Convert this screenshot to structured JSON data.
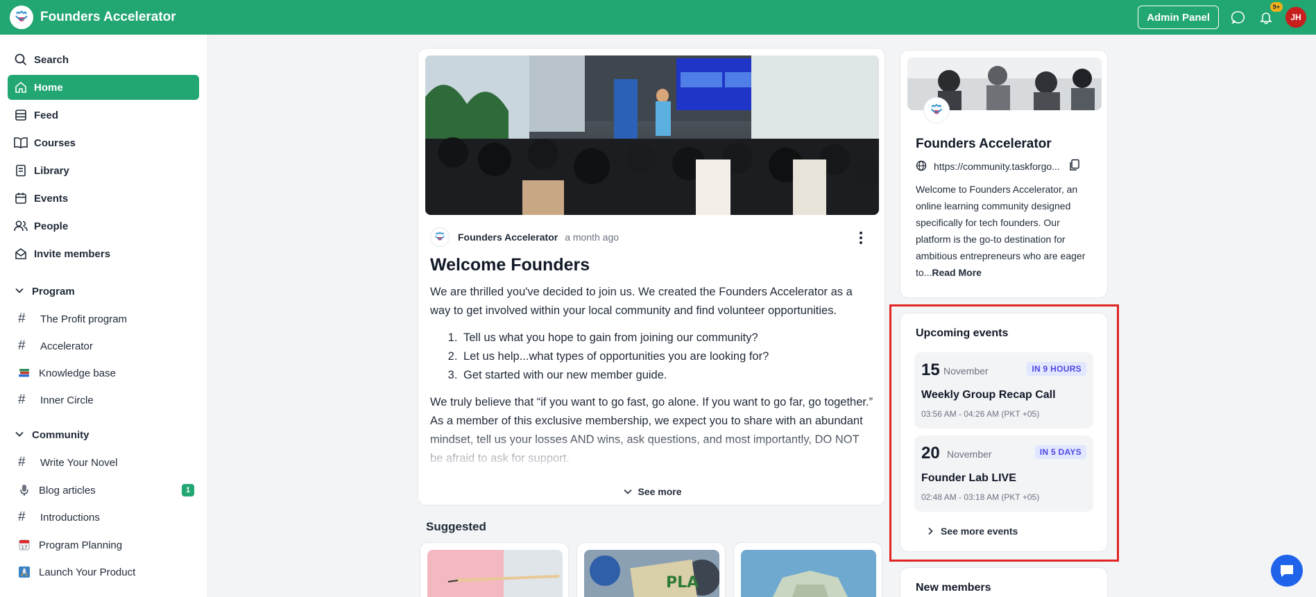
{
  "app": {
    "name": "Founders Accelerator"
  },
  "header": {
    "admin_label": "Admin Panel",
    "notif_count": "9+",
    "avatar_initials": "JH"
  },
  "sidebar": {
    "search_label": "Search",
    "items": [
      {
        "label": "Home",
        "icon": "home-icon"
      },
      {
        "label": "Feed",
        "icon": "feed-icon"
      },
      {
        "label": "Courses",
        "icon": "book-icon"
      },
      {
        "label": "Library",
        "icon": "library-icon"
      },
      {
        "label": "Events",
        "icon": "calendar-icon"
      },
      {
        "label": "People",
        "icon": "people-icon"
      },
      {
        "label": "Invite members",
        "icon": "envelope-icon"
      }
    ],
    "program": {
      "title": "Program",
      "channels": [
        {
          "label": "The Profit program",
          "icon": "hash-icon"
        },
        {
          "label": "Accelerator",
          "icon": "hash-icon"
        },
        {
          "label": "Knowledge base",
          "icon": "books-emoji-icon"
        },
        {
          "label": "Inner Circle",
          "icon": "hash-icon"
        }
      ]
    },
    "community": {
      "title": "Community",
      "channels": [
        {
          "label": "Write Your Novel",
          "icon": "hash-icon"
        },
        {
          "label": "Blog articles",
          "icon": "microphone-emoji-icon",
          "badge": "1"
        },
        {
          "label": "Introductions",
          "icon": "hash-icon"
        },
        {
          "label": "Program Planning",
          "icon": "calendar-emoji-icon"
        },
        {
          "label": "Launch Your Product",
          "icon": "rocket-emoji-icon"
        }
      ]
    }
  },
  "post": {
    "author": "Founders Accelerator",
    "time": "a month ago",
    "title": "Welcome Founders",
    "intro": "We are thrilled you've decided to join us. We created the Founders Accelerator as a way to get involved within your local community and find volunteer opportunities.",
    "list": [
      "Tell us what you hope to gain from joining our community?",
      "Let us help...what types of opportunities you are looking for?",
      "Get started with our new member guide."
    ],
    "closing": "We truly believe that “if you want to go fast, go alone. If you want to go far, go together.” As a member of this exclusive membership, we expect you to share with an abundant mindset, tell us your losses AND wins, ask questions, and most importantly, DO NOT be afraid to ask for support.",
    "see_more": "See more"
  },
  "suggested": {
    "title": "Suggested"
  },
  "about": {
    "name": "Founders Accelerator",
    "url": "https://community.taskforgo...",
    "description": "Welcome to Founders Accelerator, an online learning community designed specifically for tech founders. Our platform is the go-to destination for ambitious entrepreneurs who are eager to...",
    "read_more": "Read More"
  },
  "events": {
    "title": "Upcoming events",
    "items": [
      {
        "day": "15",
        "month": "November",
        "badge": "IN 9 HOURS",
        "name": "Weekly Group Recap Call",
        "time": "03:56 AM - 04:26 AM (PKT +05)"
      },
      {
        "day": "20",
        "month": "November",
        "badge": "IN 5 DAYS",
        "name": "Founder Lab LIVE",
        "time": "02:48 AM - 03:18 AM (PKT +05)"
      }
    ],
    "see_more": "See more events"
  },
  "members": {
    "title": "New members"
  },
  "colors": {
    "brand": "#22a672",
    "highlight": "#e02424",
    "badge_text": "#4f46e5",
    "badge_bg": "#e0e7ff",
    "fab": "#1e63e9"
  }
}
